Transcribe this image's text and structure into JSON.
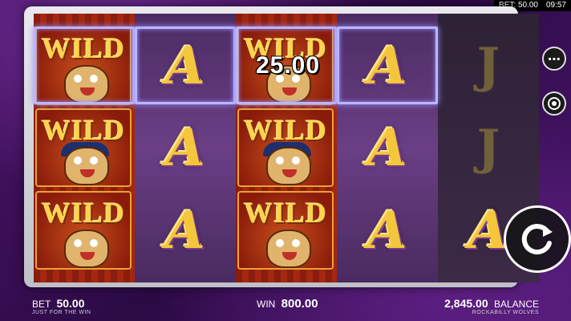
{
  "status_bar": {
    "bet_text": "BET: 50.00",
    "time": "09:57"
  },
  "reels": [
    [
      "WILD",
      "WILD",
      "WILD"
    ],
    [
      "A",
      "A",
      "A"
    ],
    [
      "WILD",
      "WILD",
      "WILD"
    ],
    [
      "A",
      "A",
      "A"
    ],
    [
      "J",
      "J",
      "A"
    ]
  ],
  "win_popup": "25.00",
  "bottom_bar": {
    "bet_label": "BET",
    "bet_value": "50.00",
    "tagline": "JUST FOR THE WIN",
    "win_label": "WIN",
    "win_value": "800.00",
    "balance_value": "2,845.00",
    "balance_label": "BALANCE",
    "game_name": "ROCKABILLY WOLVES"
  },
  "buttons": {
    "menu_icon": "more-icon",
    "chip_icon": "bet-chip-icon",
    "spin_icon": "spin-icon"
  },
  "colors": {
    "win_outline": "#b9b6ff",
    "gold": "#f4c63c",
    "background": "#3a0f57"
  }
}
